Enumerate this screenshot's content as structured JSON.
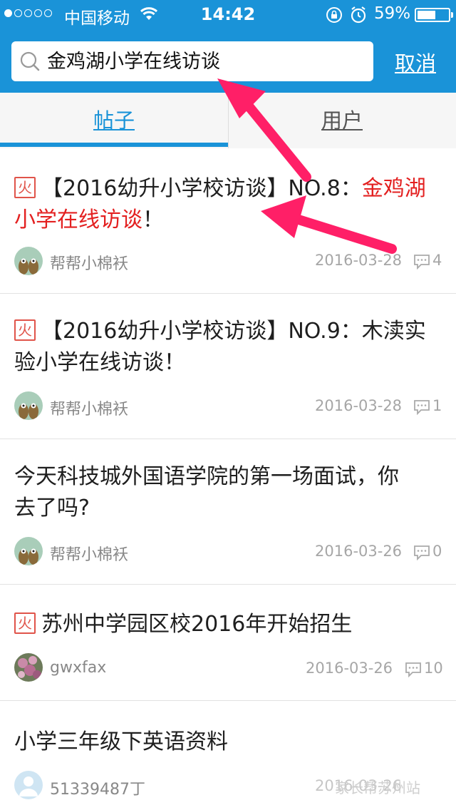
{
  "status_bar": {
    "carrier": "中国移动",
    "time": "14:42",
    "battery_percent": "59%",
    "battery_level": 0.59,
    "icons": [
      "signal-dots",
      "wifi-icon",
      "rotation-lock-icon",
      "alarm-icon",
      "battery-icon"
    ]
  },
  "search": {
    "query": "金鸡湖小学在线访谈",
    "cancel_label": "取消"
  },
  "tabs": [
    {
      "label": "帖子",
      "active": true
    },
    {
      "label": "用户",
      "active": false
    }
  ],
  "posts": [
    {
      "hot_badge": "火",
      "title_plain": "【2016幼升小学校访谈】NO.8：",
      "title_highlight_1": "金鸡湖",
      "title_highlight_2": "小学在线访谈",
      "title_suffix": "！",
      "author": "帮帮小棉袄",
      "date": "2016-03-28",
      "comments": "4"
    },
    {
      "hot_badge": "火",
      "title_line1": "【2016幼升小学校访谈】NO.9：木渎实",
      "title_line2": "验小学在线访谈！",
      "author": "帮帮小棉袄",
      "date": "2016-03-28",
      "comments": "1"
    },
    {
      "title_line1": "今天科技城外国语学院的第一场面试，你",
      "title_line2": "去了吗?",
      "author": "帮帮小棉袄",
      "date": "2016-03-26",
      "comments": "0"
    },
    {
      "hot_badge": "火",
      "title_line1": "苏州中学园区校2016年开始招生",
      "author": "gwxfax",
      "date": "2016-03-26",
      "comments": "10"
    },
    {
      "title_line1": "小学三年级下英语资料",
      "author": "51339487丁",
      "date": "2016-03-26"
    }
  ],
  "watermark": "家长帮苏州站"
}
